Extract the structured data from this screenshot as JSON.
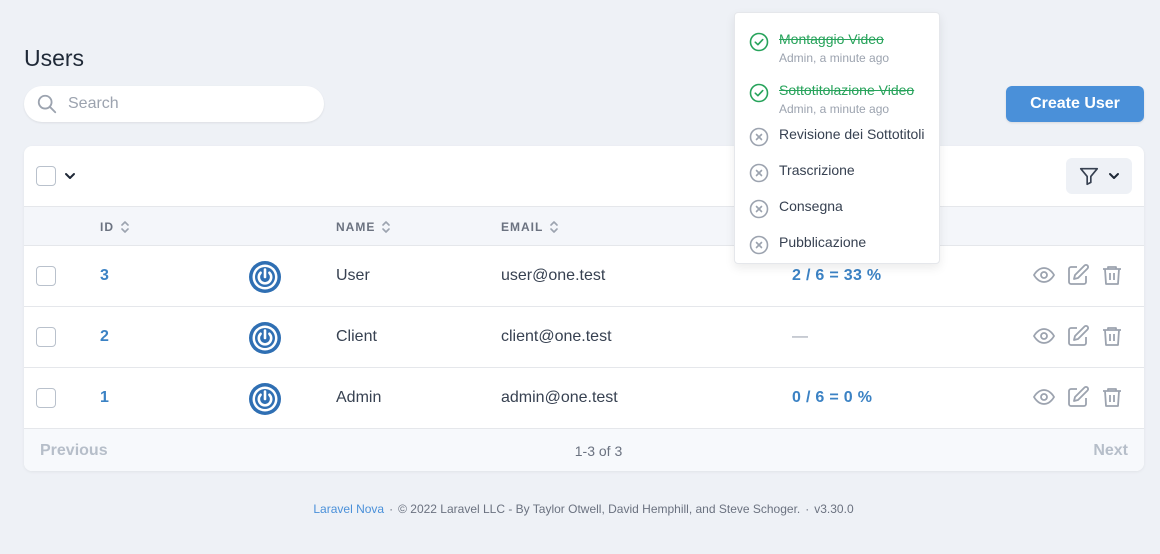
{
  "page": {
    "title": "Users"
  },
  "search": {
    "placeholder": "Search"
  },
  "create_button": {
    "label": "Create User"
  },
  "table": {
    "columns": {
      "id": "ID",
      "name": "NAME",
      "email": "EMAIL"
    },
    "rows": [
      {
        "id": "3",
        "name": "User",
        "email": "user@one.test",
        "progress": "2 / 6 = 33 %"
      },
      {
        "id": "2",
        "name": "Client",
        "email": "client@one.test",
        "progress": "—"
      },
      {
        "id": "1",
        "name": "Admin",
        "email": "admin@one.test",
        "progress": "0 / 6 = 0 %"
      }
    ]
  },
  "pagination": {
    "previous": "Previous",
    "info": "1-3 of 3",
    "next": "Next"
  },
  "footer": {
    "link": "Laravel Nova",
    "separator": "·",
    "copyright": "© 2022 Laravel LLC - By Taylor Otwell, David Hemphill, and Steve Schoger.",
    "version": "v3.30.0"
  },
  "checklist": {
    "items": [
      {
        "label": "Montaggio Video",
        "done": true,
        "meta": "Admin, a minute ago"
      },
      {
        "label": "Sottotitolazione Video",
        "done": true,
        "meta": "Admin, a minute ago"
      },
      {
        "label": "Revisione dei Sottotitoli",
        "done": false
      },
      {
        "label": "Trascrizione",
        "done": false
      },
      {
        "label": "Consegna",
        "done": false
      },
      {
        "label": "Pubblicazione",
        "done": false
      }
    ]
  },
  "colors": {
    "accent": "#4a90d9",
    "link": "#3b82c4",
    "done": "#27a35b",
    "muted": "#9ca3af",
    "avatar": "#2f6fb3"
  },
  "icons": {
    "search": "search-icon",
    "filter": "filter-icon",
    "chevron": "chevron-down-icon",
    "sort": "sort-icon",
    "avatar": "power-icon",
    "view": "eye-icon",
    "edit": "edit-icon",
    "delete": "trash-icon",
    "done": "check-circle-icon",
    "pending": "x-circle-icon"
  }
}
